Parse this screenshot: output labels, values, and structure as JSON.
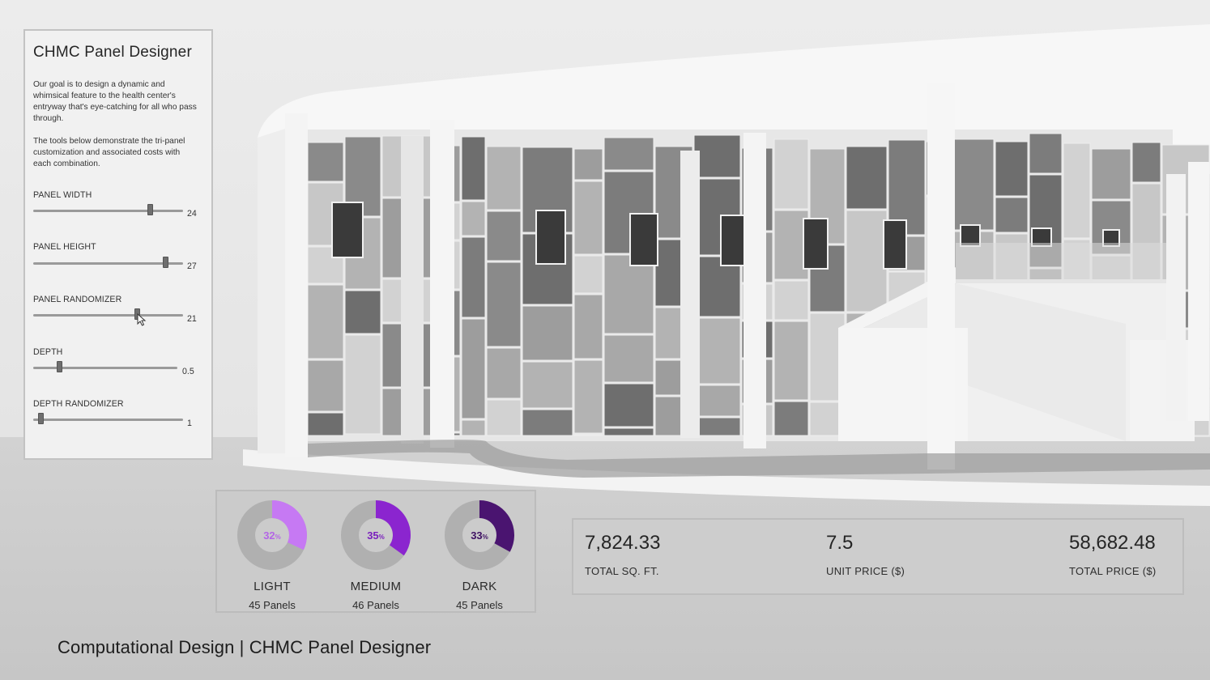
{
  "panel": {
    "title": "CHMC Panel Designer",
    "description_1": "Our goal is to design a dynamic and whimsical feature to the health center's entryway that's eye-catching for all who pass through.",
    "description_2": "The tools below demonstrate the tri-panel customization and associated costs with each combination.",
    "sliders": [
      {
        "label": "PANEL WIDTH",
        "value": "24",
        "level": 0.78
      },
      {
        "label": "PANEL HEIGHT",
        "value": "27",
        "level": 0.88
      },
      {
        "label": "PANEL RANDOMIZER",
        "value": "21",
        "level": 0.69
      },
      {
        "label": "DEPTH",
        "value": "0.5",
        "level": 0.18
      },
      {
        "label": "DEPTH RANDOMIZER",
        "value": "1",
        "level": 0.05
      }
    ]
  },
  "donuts": [
    {
      "label": "LIGHT",
      "percent": 32,
      "percent_text": "32",
      "unit": "%",
      "panels": "45 Panels",
      "color": "#c679f3",
      "text_color": "#b465e6"
    },
    {
      "label": "MEDIUM",
      "percent": 35,
      "percent_text": "35",
      "unit": "%",
      "panels": "46 Panels",
      "color": "#8b25cf",
      "text_color": "#7a1fbd"
    },
    {
      "label": "DARK",
      "percent": 33,
      "percent_text": "33",
      "unit": "%",
      "panels": "45 Panels",
      "color": "#4a1470",
      "text_color": "#3f1263"
    }
  ],
  "totals": {
    "sqft_value": "7,824.33",
    "sqft_label": "TOTAL SQ. FT.",
    "unit_value": "7.5",
    "unit_label": "UNIT PRICE ($)",
    "price_value": "58,682.48",
    "price_label": "TOTAL PRICE ($)"
  },
  "caption": "Computational Design | CHMC Panel Designer",
  "icons": {
    "cursor": "cursor-arrow-icon"
  }
}
